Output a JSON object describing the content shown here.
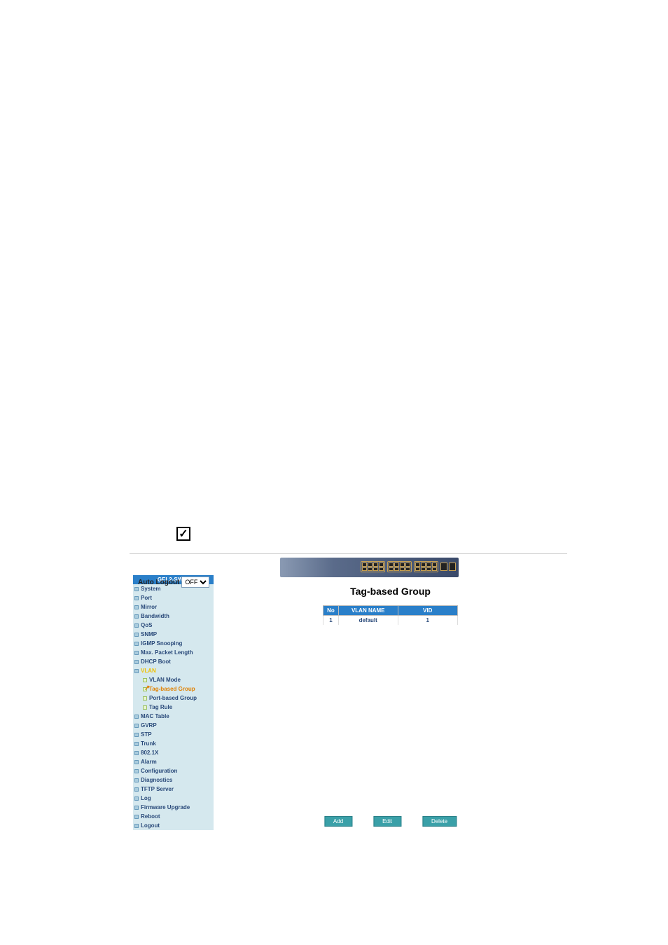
{
  "checkbox_mark": "✓",
  "auto_logout": {
    "label": "Auto Logout",
    "value": "OFF"
  },
  "sidebar": {
    "header": "GEL2-SW24",
    "items": [
      {
        "label": "System"
      },
      {
        "label": "Port"
      },
      {
        "label": "Mirror"
      },
      {
        "label": "Bandwidth"
      },
      {
        "label": "QoS"
      },
      {
        "label": "SNMP"
      },
      {
        "label": "IGMP Snooping"
      },
      {
        "label": "Max. Packet Length"
      },
      {
        "label": "DHCP Boot"
      },
      {
        "label": "VLAN",
        "expanded": true,
        "children": [
          {
            "label": "VLAN Mode"
          },
          {
            "label": "Tag-based Group",
            "active": true,
            "cursor": true
          },
          {
            "label": "Port-based Group"
          },
          {
            "label": "Tag Rule"
          }
        ]
      },
      {
        "label": "MAC Table"
      },
      {
        "label": "GVRP"
      },
      {
        "label": "STP"
      },
      {
        "label": "Trunk"
      },
      {
        "label": "802.1X"
      },
      {
        "label": "Alarm"
      },
      {
        "label": "Configuration"
      },
      {
        "label": "Diagnostics"
      },
      {
        "label": "TFTP Server"
      },
      {
        "label": "Log"
      },
      {
        "label": "Firmware Upgrade"
      },
      {
        "label": "Reboot"
      },
      {
        "label": "Logout"
      }
    ]
  },
  "main": {
    "title": "Tag-based Group",
    "table": {
      "headers": {
        "no": "No",
        "name": "VLAN NAME",
        "vid": "VID"
      },
      "rows": [
        {
          "no": "1",
          "name": "default",
          "vid": "1"
        }
      ]
    },
    "buttons": {
      "add": "Add",
      "edit": "Edit",
      "delete": "Delete"
    }
  }
}
